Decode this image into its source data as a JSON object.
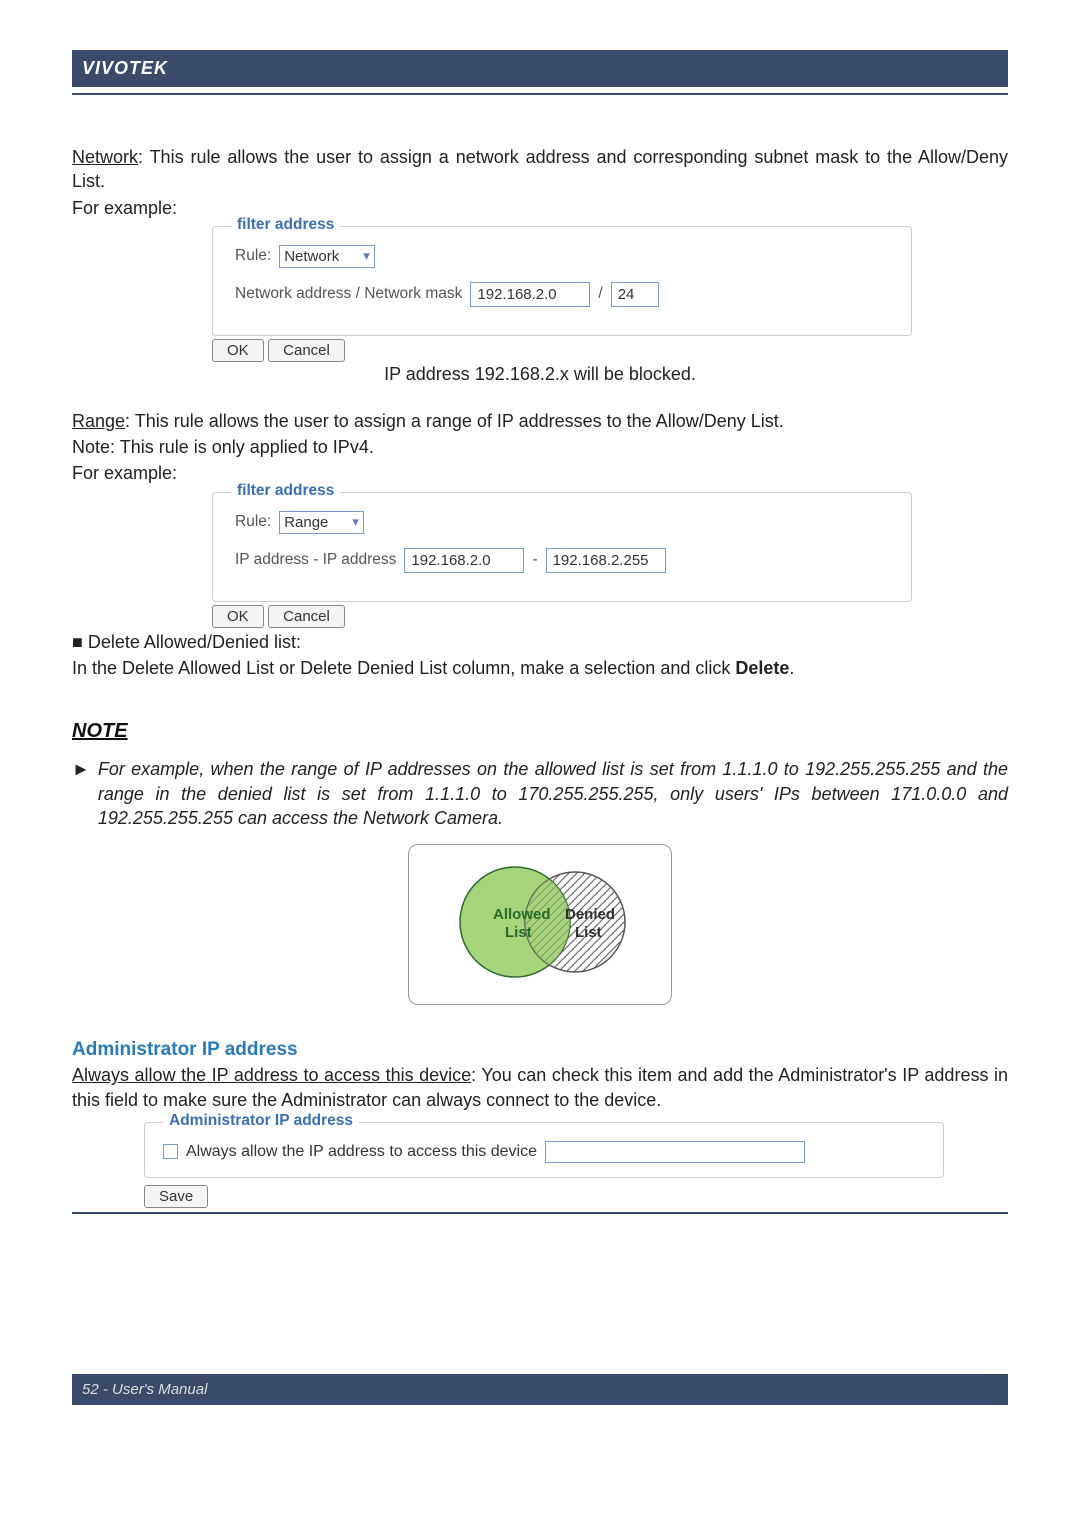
{
  "header": {
    "brand": "VIVOTEK"
  },
  "section1": {
    "network_label": "Network",
    "network_desc": ": This rule allows the user to assign a network address and corresponding subnet mask to the Allow/Deny List.",
    "for_example": "For example:",
    "fs_legend": "filter address",
    "rule_label": "Rule:",
    "rule_value": "Network",
    "addr_label": "Network address / Network mask",
    "addr_value": "192.168.2.0",
    "slash": "/",
    "mask_value": "24",
    "ok": "OK",
    "cancel": "Cancel",
    "caption": "IP address 192.168.2.x will be blocked."
  },
  "section2": {
    "range_label": "Range",
    "range_desc": ": This rule allows the user to assign a range of IP addresses to the Allow/Deny List.",
    "note_line": "Note: This rule is only applied to IPv4.",
    "for_example": "For example:",
    "fs_legend": "filter address",
    "rule_label": "Rule:",
    "rule_value": "Range",
    "ip_label": "IP address - IP address",
    "ip_from": "192.168.2.0",
    "dash": "-",
    "ip_to": "192.168.2.255",
    "ok": "OK",
    "cancel": "Cancel",
    "bullet": "■ Delete Allowed/Denied list:",
    "delete_desc_a": "In the Delete Allowed List or Delete Denied List column, make a selection and click ",
    "delete_word": "Delete",
    "delete_desc_b": "."
  },
  "note": {
    "heading": "NOTE",
    "arrow": "►",
    "text": "For example, when the range of IP addresses on the allowed list is set from 1.1.1.0 to 192.255.255.255 and the range in the denied list is set from 1.1.1.0 to 170.255.255.255, only users' IPs between 171.0.0.0 and 192.255.255.255 can access the Network Camera.",
    "venn_allowed": "Allowed",
    "venn_list": "List",
    "venn_denied": "Denied"
  },
  "admin": {
    "heading": "Administrator IP address",
    "always_label": "Always allow the IP address to access this device",
    "desc": ": You can check this item and add the Administrator's IP address in this field to make sure the Administrator can always connect to the device.",
    "fs_legend": "Administrator IP address",
    "checkbox_label": "Always allow the IP address to access this device",
    "save": "Save"
  },
  "footer": {
    "text": "52 - User's Manual"
  }
}
